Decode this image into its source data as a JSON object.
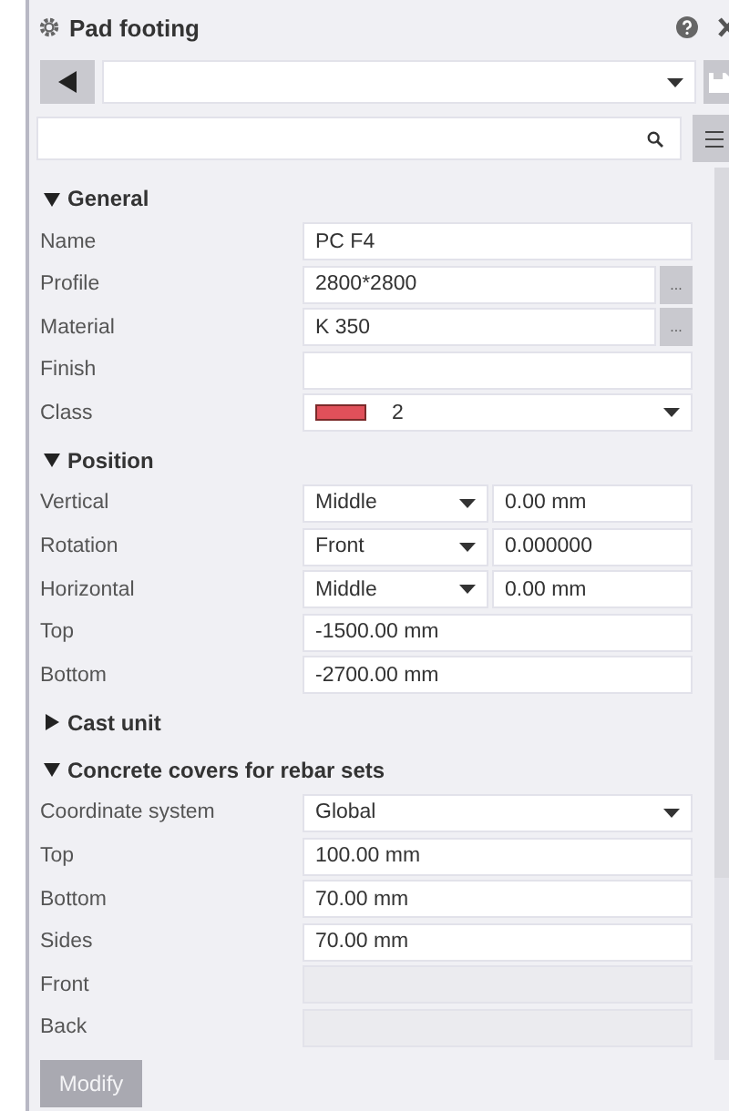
{
  "window": {
    "title": "Pad footing"
  },
  "sections": [
    {
      "title": "General",
      "expanded": true,
      "rows": [
        {
          "label": "Name",
          "kind": "text",
          "value": "PC F4"
        },
        {
          "label": "Profile",
          "kind": "browse",
          "value": "2800*2800",
          "button": "..."
        },
        {
          "label": "Material",
          "kind": "browse",
          "value": "K 350",
          "button": "..."
        },
        {
          "label": "Finish",
          "kind": "text"
        },
        {
          "label": "Class",
          "kind": "class",
          "value": "2",
          "color": "#e0505a"
        }
      ]
    },
    {
      "title": "Position",
      "expanded": true,
      "rows": [
        {
          "label": "Vertical",
          "kind": "combo",
          "option": "Middle",
          "value": "0.00 mm"
        },
        {
          "label": "Rotation",
          "kind": "combo",
          "option": "Front",
          "value": "0.000000"
        },
        {
          "label": "Horizontal",
          "kind": "combo",
          "option": "Middle",
          "value": "0.00 mm"
        },
        {
          "label": "Top",
          "kind": "text",
          "value": "-1500.00 mm"
        },
        {
          "label": "Bottom",
          "kind": "text",
          "value": "-2700.00 mm"
        }
      ]
    },
    {
      "title": "Cast unit",
      "expanded": false
    },
    {
      "title": "Concrete covers for rebar sets",
      "expanded": true,
      "rows": [
        {
          "label": "Coordinate system",
          "kind": "dropdown",
          "value": "Global"
        },
        {
          "label": "Top",
          "kind": "text",
          "value": "100.00 mm"
        },
        {
          "label": "Bottom",
          "kind": "text",
          "value": "70.00 mm"
        },
        {
          "label": "Sides",
          "kind": "text",
          "value": "70.00 mm"
        },
        {
          "label": "Front",
          "kind": "disabled"
        },
        {
          "label": "Back",
          "kind": "disabled"
        }
      ]
    }
  ],
  "modify_button": {
    "label": "Modify",
    "disabled": true
  }
}
